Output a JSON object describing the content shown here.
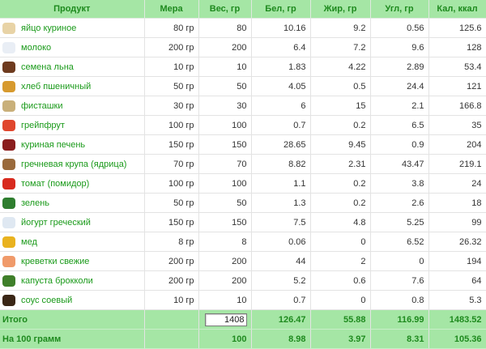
{
  "headers": [
    "Продукт",
    "Мера",
    "Вес, гр",
    "Бел, гр",
    "Жир, гр",
    "Угл, гр",
    "Кал, ккал"
  ],
  "rows": [
    {
      "name": "яйцо куриное",
      "mera": "80 гр",
      "ves": "80",
      "bel": "10.16",
      "zhir": "9.2",
      "ugl": "0.56",
      "kal": "125.6",
      "icon": "egg-icon",
      "color": "#e8d3a6"
    },
    {
      "name": "молоко",
      "mera": "200 гр",
      "ves": "200",
      "bel": "6.4",
      "zhir": "7.2",
      "ugl": "9.6",
      "kal": "128",
      "icon": "milk-icon",
      "color": "#e9eef5"
    },
    {
      "name": "семена льна",
      "mera": "10 гр",
      "ves": "10",
      "bel": "1.83",
      "zhir": "4.22",
      "ugl": "2.89",
      "kal": "53.4",
      "icon": "flax-seeds-icon",
      "color": "#6e3b1f"
    },
    {
      "name": "хлеб пшеничный",
      "mera": "50 гр",
      "ves": "50",
      "bel": "4.05",
      "zhir": "0.5",
      "ugl": "24.4",
      "kal": "121",
      "icon": "bread-icon",
      "color": "#d79a2e"
    },
    {
      "name": "фисташки",
      "mera": "30 гр",
      "ves": "30",
      "bel": "6",
      "zhir": "15",
      "ugl": "2.1",
      "kal": "166.8",
      "icon": "pistachio-icon",
      "color": "#c9b07a"
    },
    {
      "name": "грейпфрут",
      "mera": "100 гр",
      "ves": "100",
      "bel": "0.7",
      "zhir": "0.2",
      "ugl": "6.5",
      "kal": "35",
      "icon": "grapefruit-icon",
      "color": "#e0462d"
    },
    {
      "name": "куриная печень",
      "mera": "150 гр",
      "ves": "150",
      "bel": "28.65",
      "zhir": "9.45",
      "ugl": "0.9",
      "kal": "204",
      "icon": "liver-icon",
      "color": "#8b1e1e"
    },
    {
      "name": "гречневая крупа (ядрица)",
      "mera": "70 гр",
      "ves": "70",
      "bel": "8.82",
      "zhir": "2.31",
      "ugl": "43.47",
      "kal": "219.1",
      "icon": "buckwheat-icon",
      "color": "#9a6a3c"
    },
    {
      "name": "томат (помидор)",
      "mera": "100 гр",
      "ves": "100",
      "bel": "1.1",
      "zhir": "0.2",
      "ugl": "3.8",
      "kal": "24",
      "icon": "tomato-icon",
      "color": "#d82a1e"
    },
    {
      "name": "зелень",
      "mera": "50 гр",
      "ves": "50",
      "bel": "1.3",
      "zhir": "0.2",
      "ugl": "2.6",
      "kal": "18",
      "icon": "greens-icon",
      "color": "#2e7d2e"
    },
    {
      "name": "йогурт греческий",
      "mera": "150 гр",
      "ves": "150",
      "bel": "7.5",
      "zhir": "4.8",
      "ugl": "5.25",
      "kal": "99",
      "icon": "yogurt-icon",
      "color": "#dfe8f2"
    },
    {
      "name": "мед",
      "mera": "8 гр",
      "ves": "8",
      "bel": "0.06",
      "zhir": "0",
      "ugl": "6.52",
      "kal": "26.32",
      "icon": "honey-icon",
      "color": "#e9b21f"
    },
    {
      "name": "креветки свежие",
      "mera": "200 гр",
      "ves": "200",
      "bel": "44",
      "zhir": "2",
      "ugl": "0",
      "kal": "194",
      "icon": "shrimp-icon",
      "color": "#f09a6a"
    },
    {
      "name": "капуста брокколи",
      "mera": "200 гр",
      "ves": "200",
      "bel": "5.2",
      "zhir": "0.6",
      "ugl": "7.6",
      "kal": "64",
      "icon": "broccoli-icon",
      "color": "#3f7f2a"
    },
    {
      "name": "соус соевый",
      "mera": "10 гр",
      "ves": "10",
      "bel": "0.7",
      "zhir": "0",
      "ugl": "0.8",
      "kal": "5.3",
      "icon": "soy-sauce-icon",
      "color": "#3a2616"
    }
  ],
  "total": {
    "label": "Итого",
    "ves": "1408",
    "bel": "126.47",
    "zhir": "55.88",
    "ugl": "116.99",
    "kal": "1483.52"
  },
  "per100": {
    "label": "На 100 грамм",
    "ves": "100",
    "bel": "8.98",
    "zhir": "3.97",
    "ugl": "8.31",
    "kal": "105.36"
  }
}
